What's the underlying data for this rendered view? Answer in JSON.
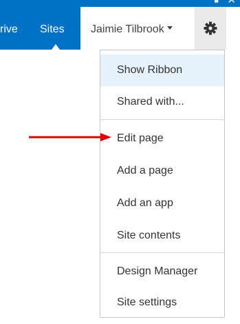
{
  "chrome": {
    "controls": [
      "⏸",
      "✕"
    ]
  },
  "suite_bar": {
    "nav": [
      "rive",
      "Sites"
    ],
    "user_name": "Jaimie Tilbrook",
    "settings_icon": "gear-icon"
  },
  "menu": {
    "items": [
      {
        "label": "Show Ribbon"
      },
      {
        "label": "Shared with..."
      },
      {
        "label": "Edit page"
      },
      {
        "label": "Add a page"
      },
      {
        "label": "Add an app"
      },
      {
        "label": "Site contents"
      },
      {
        "label": "Design Manager"
      },
      {
        "label": "Site settings"
      }
    ]
  },
  "colors": {
    "suite_blue": "#0072c6",
    "highlight": "#e5f1fb",
    "arrow": "#e00000"
  }
}
